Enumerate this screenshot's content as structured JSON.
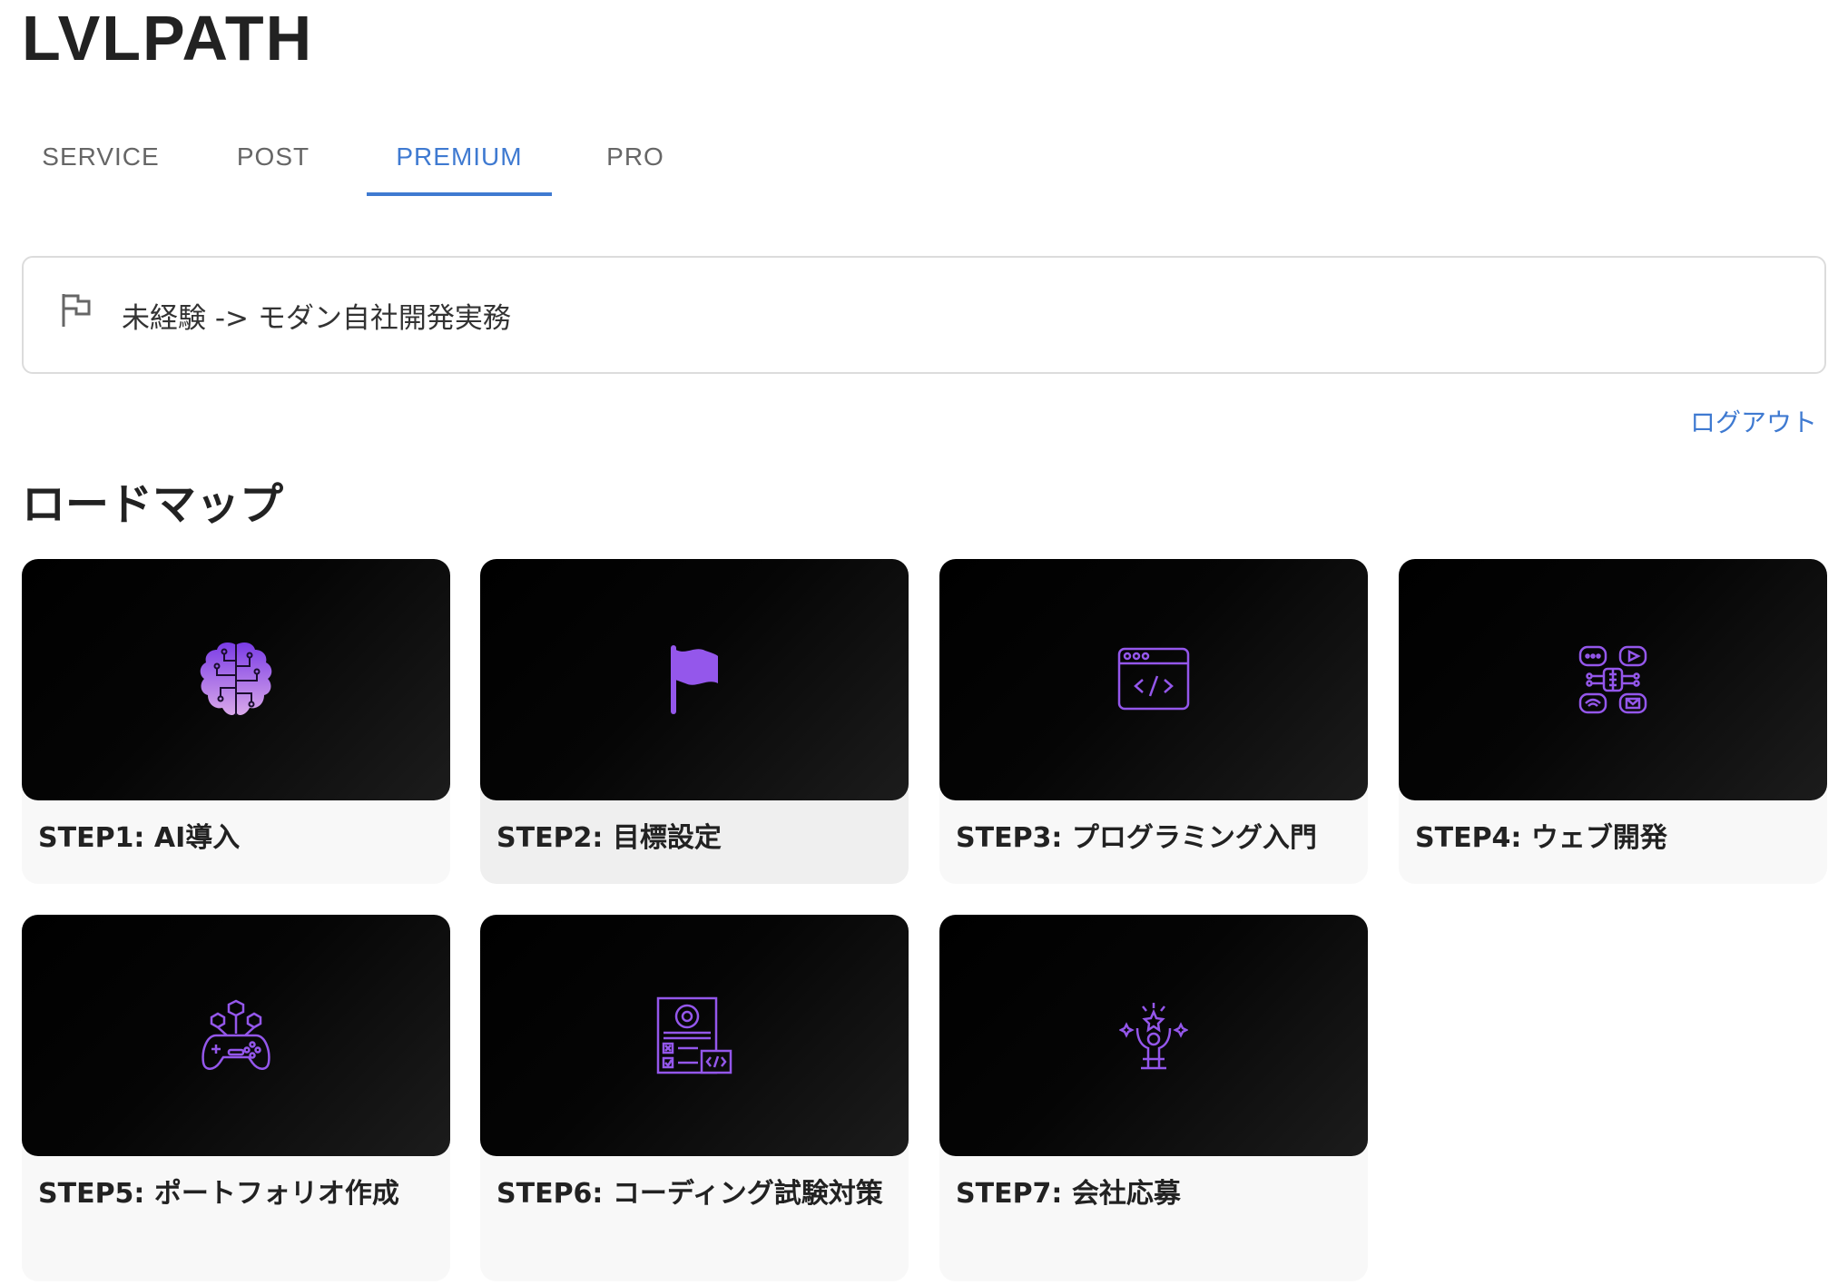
{
  "app": {
    "title": "LVLPATH"
  },
  "nav": {
    "tabs": [
      {
        "label": "SERVICE"
      },
      {
        "label": "POST"
      },
      {
        "label": "PREMIUM",
        "active": true
      },
      {
        "label": "PRO"
      }
    ]
  },
  "path": {
    "icon": "flag-outline-icon",
    "label": "未経験 -> モダン自社開発実務"
  },
  "auth": {
    "logout_label": "ログアウト"
  },
  "roadmap": {
    "title": "ロードマップ",
    "accent_color": "#9457eb",
    "steps": [
      {
        "label": "STEP1: AI導入",
        "icon": "brain-circuit-icon"
      },
      {
        "label": "STEP2: 目標設定",
        "icon": "flag-icon"
      },
      {
        "label": "STEP3: プログラミング入門",
        "icon": "code-window-icon"
      },
      {
        "label": "STEP4: ウェブ開発",
        "icon": "web-apps-network-icon"
      },
      {
        "label": "STEP5: ポートフォリオ作成",
        "icon": "game-controller-icon"
      },
      {
        "label": "STEP6: コーディング試験対策",
        "icon": "checklist-code-icon"
      },
      {
        "label": "STEP7: 会社応募",
        "icon": "celebrating-person-icon"
      }
    ]
  },
  "colors": {
    "link": "#3f7ad1",
    "text": "#222222",
    "card_bg": "#f8f8f8"
  }
}
